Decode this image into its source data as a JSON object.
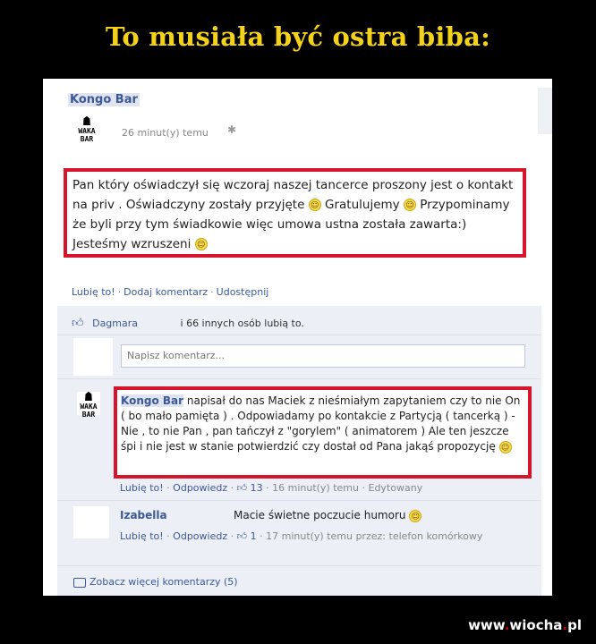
{
  "headline": "To musiała być ostra biba:",
  "post": {
    "page_name": "Kongo Bar",
    "avatar_text": "WAKA BAR",
    "timestamp": "26 minut(y) temu",
    "body_part1": "Pan który oświadczył się wczoraj naszej tancerce proszony jest o kontakt na priv . Oświadczyny zostały przyjęte",
    "body_part2": "Gratulujemy",
    "body_part3": "Przypominamy że byli przy tym świadkowie więc umowa ustna została zawarta:) Jesteśmy wzruszeni",
    "actions": {
      "like": "Lubię to!",
      "comment": "Dodaj komentarz",
      "share": "Udostępnij"
    }
  },
  "likes": {
    "first_name": "Dagmara",
    "rest": "i 66 innych osób lubią to."
  },
  "comment_input": {
    "placeholder": "Napisz komentarz..."
  },
  "comments": [
    {
      "author": "Kongo Bar",
      "text": "napisał do nas Maciek z nieśmiałym zapytaniem czy to nie On ( bo mało pamięta ) . Odpowiadamy po kontakcie z Partycją ( tancerką ) - Nie , to nie Pan , pan tańczył z \"gorylem\" ( animatorem ) Ale ten jeszcze śpi i nie jest w stanie potwierdzić czy dostał od Pana jakąś propozycję",
      "like": "Lubię to!",
      "reply": "Odpowiedz",
      "like_count": "13",
      "time": "16 minut(y) temu",
      "edited": "Edytowany"
    },
    {
      "author": "Izabella",
      "text": "Macie świetne poczucie humoru",
      "like": "Lubię to!",
      "reply": "Odpowiedz",
      "like_count": "1",
      "time": "17 minut(y) temu przez: telefon komórkowy"
    }
  ],
  "more_comments": "Zobacz więcej komentarzy (5)",
  "watermark": {
    "prefix": "www",
    "name": "wiocha",
    "tld": "pl"
  },
  "colors": {
    "highlight_border": "#d4152b",
    "link": "#3b5998",
    "headline": "#f5d21a",
    "feedback_bg": "#eceff5"
  }
}
